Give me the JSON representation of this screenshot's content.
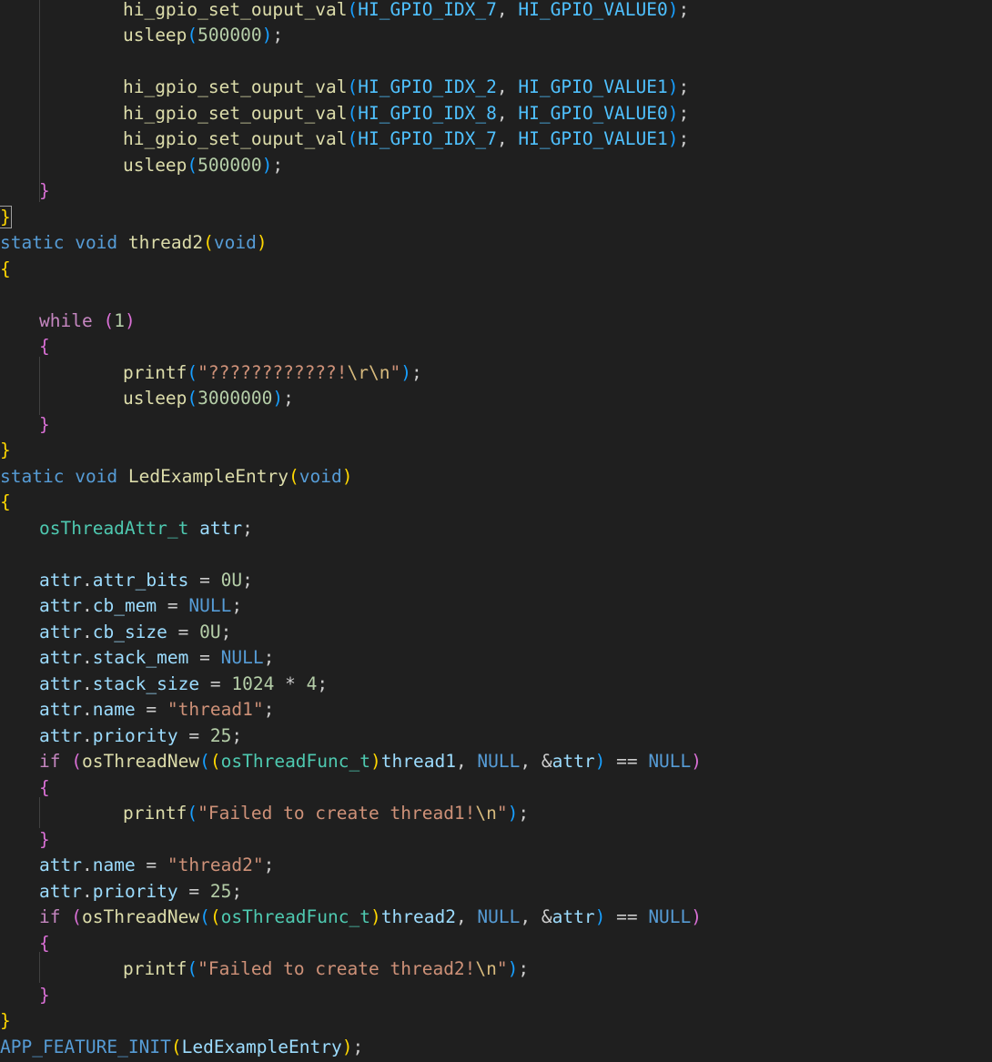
{
  "editor": {
    "lines": [
      [
        [
          "    ",
          "plain"
        ],
        [
          "hi_gpio_set_ouput_val",
          "fn"
        ],
        [
          "(",
          "b3"
        ],
        [
          "HI_GPIO_IDX_7",
          "const"
        ],
        [
          ", ",
          "plain"
        ],
        [
          "HI_GPIO_VALUE0",
          "const"
        ],
        [
          ")",
          "b3"
        ],
        [
          ";",
          "plain"
        ]
      ],
      [
        [
          "    ",
          "plain"
        ],
        [
          "usleep",
          "fn"
        ],
        [
          "(",
          "b3"
        ],
        [
          "500000",
          "num"
        ],
        [
          ")",
          "b3"
        ],
        [
          ";",
          "plain"
        ]
      ],
      [],
      [
        [
          "    ",
          "plain"
        ],
        [
          "hi_gpio_set_ouput_val",
          "fn"
        ],
        [
          "(",
          "b3"
        ],
        [
          "HI_GPIO_IDX_2",
          "const"
        ],
        [
          ", ",
          "plain"
        ],
        [
          "HI_GPIO_VALUE1",
          "const"
        ],
        [
          ")",
          "b3"
        ],
        [
          ";",
          "plain"
        ]
      ],
      [
        [
          "    ",
          "plain"
        ],
        [
          "hi_gpio_set_ouput_val",
          "fn"
        ],
        [
          "(",
          "b3"
        ],
        [
          "HI_GPIO_IDX_8",
          "const"
        ],
        [
          ", ",
          "plain"
        ],
        [
          "HI_GPIO_VALUE0",
          "const"
        ],
        [
          ")",
          "b3"
        ],
        [
          ";",
          "plain"
        ]
      ],
      [
        [
          "    ",
          "plain"
        ],
        [
          "hi_gpio_set_ouput_val",
          "fn"
        ],
        [
          "(",
          "b3"
        ],
        [
          "HI_GPIO_IDX_7",
          "const"
        ],
        [
          ", ",
          "plain"
        ],
        [
          "HI_GPIO_VALUE1",
          "const"
        ],
        [
          ")",
          "b3"
        ],
        [
          ";",
          "plain"
        ]
      ],
      [
        [
          "    ",
          "plain"
        ],
        [
          "usleep",
          "fn"
        ],
        [
          "(",
          "b3"
        ],
        [
          "500000",
          "num"
        ],
        [
          ")",
          "b3"
        ],
        [
          ";",
          "plain"
        ]
      ],
      [
        [
          "}",
          "b2"
        ]
      ],
      [
        [
          "}",
          "b1"
        ]
      ],
      [
        [
          "static",
          "kw"
        ],
        [
          " ",
          "plain"
        ],
        [
          "void",
          "kw"
        ],
        [
          " ",
          "plain"
        ],
        [
          "thread2",
          "fn"
        ],
        [
          "(",
          "b1"
        ],
        [
          "void",
          "kw"
        ],
        [
          ")",
          "b1"
        ]
      ],
      [
        [
          "{",
          "b1"
        ]
      ],
      [],
      [
        [
          "while",
          "ctl"
        ],
        [
          " ",
          "plain"
        ],
        [
          "(",
          "b2"
        ],
        [
          "1",
          "num"
        ],
        [
          ")",
          "b2"
        ]
      ],
      [
        [
          "{",
          "b2"
        ]
      ],
      [
        [
          "    ",
          "plain"
        ],
        [
          "printf",
          "fn"
        ],
        [
          "(",
          "b3"
        ],
        [
          "\"????????????!",
          "str"
        ],
        [
          "\\r\\n",
          "esc"
        ],
        [
          "\"",
          "str"
        ],
        [
          ")",
          "b3"
        ],
        [
          ";",
          "plain"
        ]
      ],
      [
        [
          "    ",
          "plain"
        ],
        [
          "usleep",
          "fn"
        ],
        [
          "(",
          "b3"
        ],
        [
          "3000000",
          "num"
        ],
        [
          ")",
          "b3"
        ],
        [
          ";",
          "plain"
        ]
      ],
      [
        [
          "}",
          "b2"
        ]
      ],
      [
        [
          "}",
          "b1"
        ]
      ],
      [
        [
          "static",
          "kw"
        ],
        [
          " ",
          "plain"
        ],
        [
          "void",
          "kw"
        ],
        [
          " ",
          "plain"
        ],
        [
          "LedExampleEntry",
          "fn"
        ],
        [
          "(",
          "b1"
        ],
        [
          "void",
          "kw"
        ],
        [
          ")",
          "b1"
        ]
      ],
      [
        [
          "{",
          "b1"
        ]
      ],
      [
        [
          "osThreadAttr_t",
          "type"
        ],
        [
          " ",
          "plain"
        ],
        [
          "attr",
          "var"
        ],
        [
          ";",
          "plain"
        ]
      ],
      [],
      [
        [
          "attr",
          "var"
        ],
        [
          ".",
          "plain"
        ],
        [
          "attr_bits",
          "var"
        ],
        [
          " = ",
          "plain"
        ],
        [
          "0U",
          "num"
        ],
        [
          ";",
          "plain"
        ]
      ],
      [
        [
          "attr",
          "var"
        ],
        [
          ".",
          "plain"
        ],
        [
          "cb_mem",
          "var"
        ],
        [
          " = ",
          "plain"
        ],
        [
          "NULL",
          "kw"
        ],
        [
          ";",
          "plain"
        ]
      ],
      [
        [
          "attr",
          "var"
        ],
        [
          ".",
          "plain"
        ],
        [
          "cb_size",
          "var"
        ],
        [
          " = ",
          "plain"
        ],
        [
          "0U",
          "num"
        ],
        [
          ";",
          "plain"
        ]
      ],
      [
        [
          "attr",
          "var"
        ],
        [
          ".",
          "plain"
        ],
        [
          "stack_mem",
          "var"
        ],
        [
          " = ",
          "plain"
        ],
        [
          "NULL",
          "kw"
        ],
        [
          ";",
          "plain"
        ]
      ],
      [
        [
          "attr",
          "var"
        ],
        [
          ".",
          "plain"
        ],
        [
          "stack_size",
          "var"
        ],
        [
          " = ",
          "plain"
        ],
        [
          "1024",
          "num"
        ],
        [
          " * ",
          "plain"
        ],
        [
          "4",
          "num"
        ],
        [
          ";",
          "plain"
        ]
      ],
      [
        [
          "attr",
          "var"
        ],
        [
          ".",
          "plain"
        ],
        [
          "name",
          "var"
        ],
        [
          " = ",
          "plain"
        ],
        [
          "\"thread1\"",
          "str"
        ],
        [
          ";",
          "plain"
        ]
      ],
      [
        [
          "attr",
          "var"
        ],
        [
          ".",
          "plain"
        ],
        [
          "priority",
          "var"
        ],
        [
          " = ",
          "plain"
        ],
        [
          "25",
          "num"
        ],
        [
          ";",
          "plain"
        ]
      ],
      [
        [
          "if",
          "ctl"
        ],
        [
          " ",
          "plain"
        ],
        [
          "(",
          "b2"
        ],
        [
          "osThreadNew",
          "fn"
        ],
        [
          "(",
          "b3"
        ],
        [
          "(",
          "b1"
        ],
        [
          "osThreadFunc_t",
          "type"
        ],
        [
          ")",
          "b1"
        ],
        [
          "thread1",
          "var"
        ],
        [
          ", ",
          "plain"
        ],
        [
          "NULL",
          "kw"
        ],
        [
          ", &",
          "plain"
        ],
        [
          "attr",
          "var"
        ],
        [
          ")",
          "b3"
        ],
        [
          " == ",
          "plain"
        ],
        [
          "NULL",
          "kw"
        ],
        [
          ")",
          "b2"
        ]
      ],
      [
        [
          "{",
          "b2"
        ]
      ],
      [
        [
          "    ",
          "plain"
        ],
        [
          "printf",
          "fn"
        ],
        [
          "(",
          "b3"
        ],
        [
          "\"Failed to create thread1!",
          "str"
        ],
        [
          "\\n",
          "esc"
        ],
        [
          "\"",
          "str"
        ],
        [
          ")",
          "b3"
        ],
        [
          ";",
          "plain"
        ]
      ],
      [
        [
          "}",
          "b2"
        ]
      ],
      [
        [
          "attr",
          "var"
        ],
        [
          ".",
          "plain"
        ],
        [
          "name",
          "var"
        ],
        [
          " = ",
          "plain"
        ],
        [
          "\"thread2\"",
          "str"
        ],
        [
          ";",
          "plain"
        ]
      ],
      [
        [
          "attr",
          "var"
        ],
        [
          ".",
          "plain"
        ],
        [
          "priority",
          "var"
        ],
        [
          " = ",
          "plain"
        ],
        [
          "25",
          "num"
        ],
        [
          ";",
          "plain"
        ]
      ],
      [
        [
          "if",
          "ctl"
        ],
        [
          " ",
          "plain"
        ],
        [
          "(",
          "b2"
        ],
        [
          "osThreadNew",
          "fn"
        ],
        [
          "(",
          "b3"
        ],
        [
          "(",
          "b1"
        ],
        [
          "osThreadFunc_t",
          "type"
        ],
        [
          ")",
          "b1"
        ],
        [
          "thread2",
          "var"
        ],
        [
          ", ",
          "plain"
        ],
        [
          "NULL",
          "kw"
        ],
        [
          ", &",
          "plain"
        ],
        [
          "attr",
          "var"
        ],
        [
          ")",
          "b3"
        ],
        [
          " == ",
          "plain"
        ],
        [
          "NULL",
          "kw"
        ],
        [
          ")",
          "b2"
        ]
      ],
      [
        [
          "{",
          "b2"
        ]
      ],
      [
        [
          "    ",
          "plain"
        ],
        [
          "printf",
          "fn"
        ],
        [
          "(",
          "b3"
        ],
        [
          "\"Failed to create thread2!",
          "str"
        ],
        [
          "\\n",
          "esc"
        ],
        [
          "\"",
          "str"
        ],
        [
          ")",
          "b3"
        ],
        [
          ";",
          "plain"
        ]
      ],
      [
        [
          "}",
          "b2"
        ]
      ],
      [
        [
          "}",
          "b1"
        ]
      ],
      [
        [
          "APP_FEATURE_INIT",
          "macro"
        ],
        [
          "(",
          "b1"
        ],
        [
          "LedExampleEntry",
          "var"
        ],
        [
          ")",
          "b1"
        ],
        [
          ";",
          "plain"
        ]
      ]
    ]
  }
}
